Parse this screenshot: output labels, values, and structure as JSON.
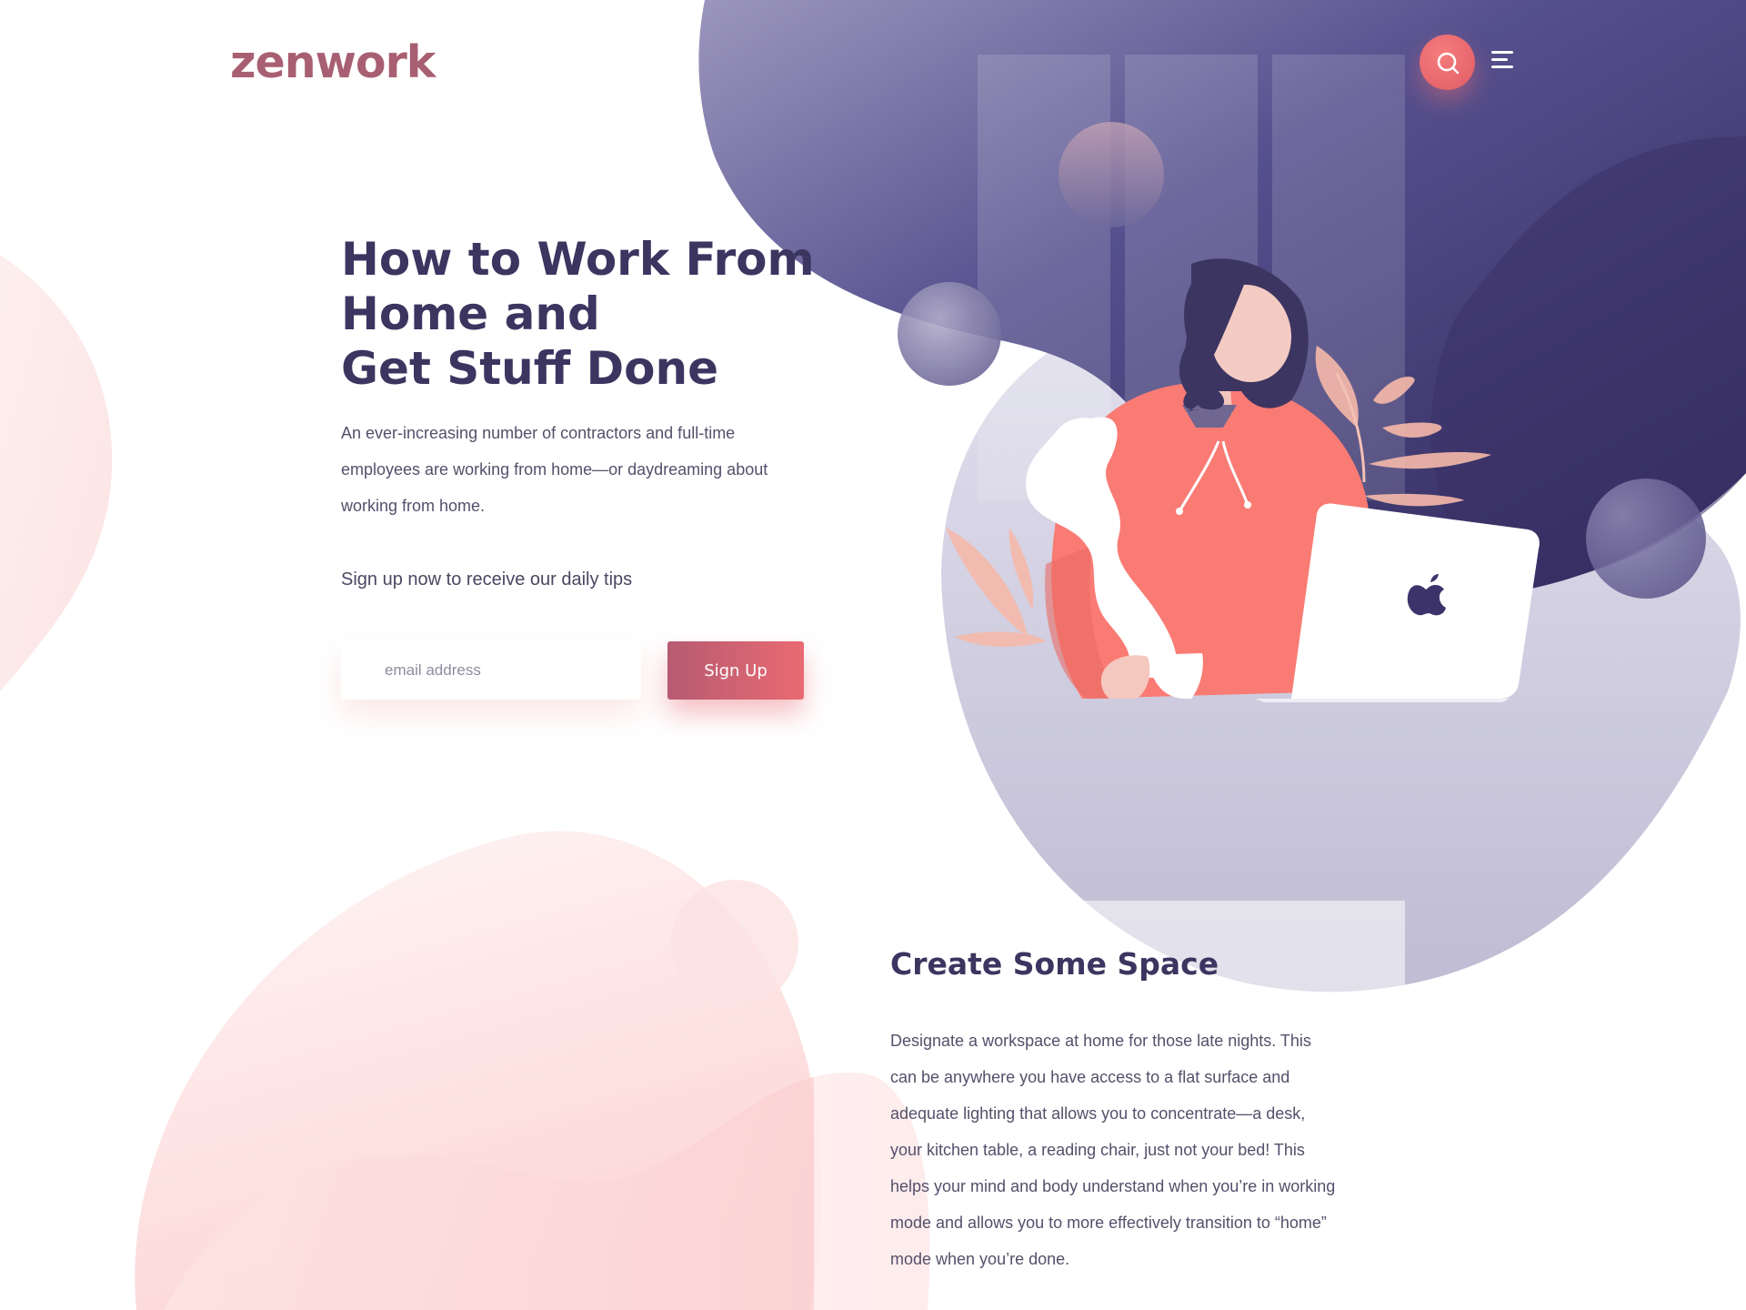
{
  "brand": {
    "logo_text": "zenwork",
    "logo_color": "#a85f72"
  },
  "header": {
    "search_icon": "search-icon",
    "menu_icon": "hamburger-menu-icon"
  },
  "hero": {
    "title_lines": [
      "How to Work From",
      "Home and",
      "Get Stuff Done"
    ],
    "description": "An ever-increasing number of contractors and full-time employees are working from home—or daydreaming about working from home.",
    "signup_prompt": "Sign up now to receive our daily tips",
    "email_placeholder": "email address",
    "signup_button_label": "Sign Up"
  },
  "section": {
    "title": "Create Some Space",
    "body": "Designate a workspace at home for those late nights. This can be anywhere you have access to a flat surface and adequate lighting that allows you to concentrate—a desk, your kitchen table, a reading chair, just not your bed! This helps your mind and body understand when you’re in working mode and allows you to more effectively transition to “home” mode when you’re done."
  },
  "illustration": {
    "subject": "woman-working-on-laptop-illustration",
    "laptop_logo_icon": "apple-icon"
  },
  "colors": {
    "heading": "#3b3560",
    "body_text": "#54506b",
    "accent": "#e96a72",
    "accent_dark": "#b65b72",
    "purple_dark": "#3c336b",
    "purple_light": "#cbc8dc",
    "pink_light": "#fbd4d4"
  }
}
